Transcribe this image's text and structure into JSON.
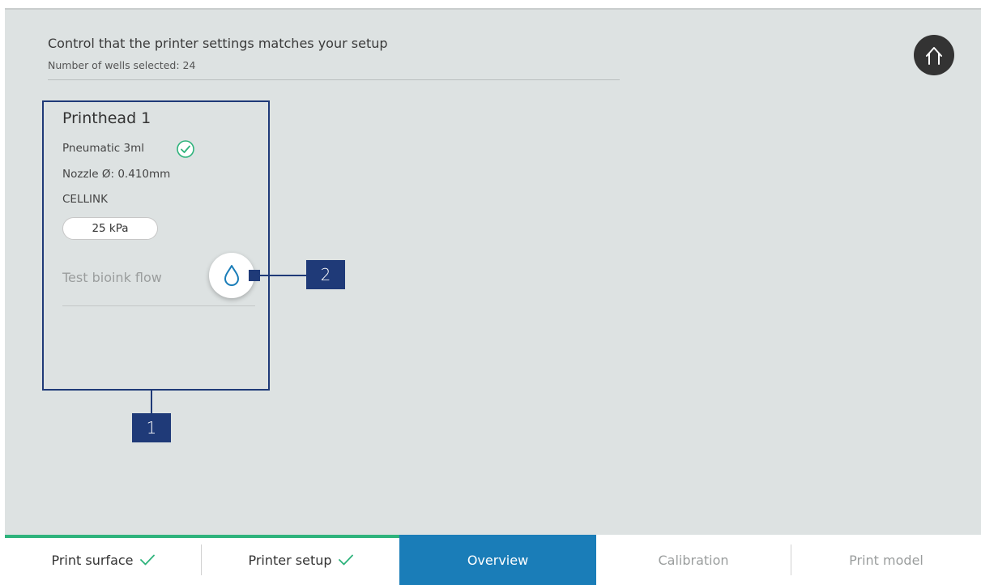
{
  "header": {
    "title": "Control that the printer settings matches your setup",
    "subtitle": "Number of wells selected: 24"
  },
  "home_button": {
    "icon": "home-icon"
  },
  "printhead": {
    "title": "Printhead 1",
    "type": "Pneumatic 3ml",
    "type_status_icon": "check-circle-icon",
    "nozzle": "Nozzle Ø: 0.410mm",
    "brand": "CELLINK",
    "pressure": "25 kPa",
    "test_label": "Test bioink flow",
    "test_icon": "droplet-icon"
  },
  "callouts": [
    "1",
    "2"
  ],
  "nav": {
    "items": [
      {
        "label": "Print surface",
        "state": "done"
      },
      {
        "label": "Printer setup",
        "state": "done"
      },
      {
        "label": "Overview",
        "state": "active"
      },
      {
        "label": "Calibration",
        "state": "future"
      },
      {
        "label": "Print model",
        "state": "future"
      }
    ]
  },
  "colors": {
    "accent": "#1a7db8",
    "success": "#2eb37c",
    "callout": "#1f3a78",
    "background": "#dde2e2"
  }
}
